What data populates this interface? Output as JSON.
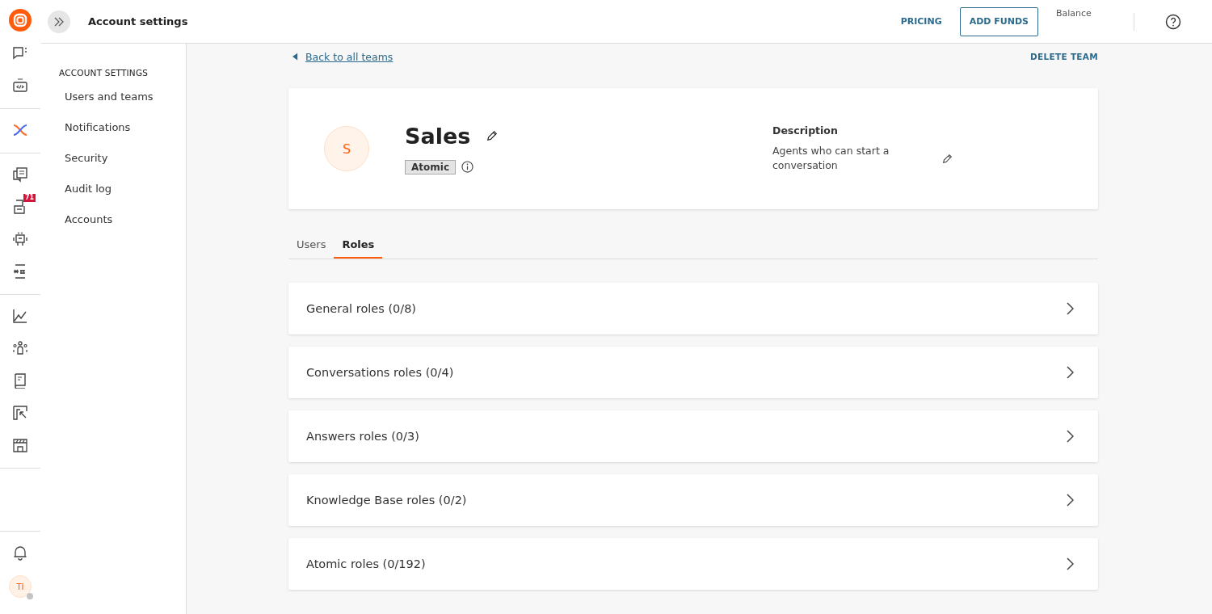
{
  "header": {
    "title": "Account settings",
    "pricing": "PRICING",
    "add_funds": "ADD FUNDS",
    "balance_label": "Balance"
  },
  "rail": {
    "badge": "71",
    "avatar": "TI"
  },
  "sidebar": {
    "heading": "ACCOUNT SETTINGS",
    "items": [
      {
        "label": "Users and teams",
        "selected": false
      },
      {
        "label": "Notifications",
        "selected": false
      },
      {
        "label": "Security",
        "selected": false
      },
      {
        "label": "Audit log",
        "selected": false
      },
      {
        "label": "Accounts",
        "selected": false
      }
    ]
  },
  "back_link": "Back to all teams",
  "delete_team": "DELETE TEAM",
  "team": {
    "initial": "S",
    "name": "Sales",
    "tag": "Atomic",
    "description_label": "Description",
    "description": "Agents who can start a conversation"
  },
  "tabs": [
    {
      "label": "Users",
      "selected": false
    },
    {
      "label": "Roles",
      "selected": true
    }
  ],
  "role_groups": [
    "General roles (0/8)",
    "Conversations roles (0/4)",
    "Answers roles (0/3)",
    "Knowledge Base roles (0/2)",
    "Atomic roles (0/192)"
  ]
}
